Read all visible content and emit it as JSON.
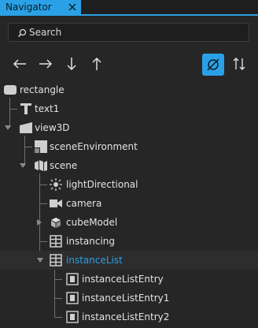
{
  "window": {
    "tab_title": "Navigator"
  },
  "search": {
    "placeholder": "Search",
    "value": ""
  },
  "toolbar": {
    "buttons": [
      {
        "icon": "arrow-left-icon"
      },
      {
        "icon": "arrow-right-icon"
      },
      {
        "icon": "arrow-down-icon"
      },
      {
        "icon": "arrow-up-icon"
      },
      {
        "icon": "hide-unused-icon",
        "active": true
      },
      {
        "icon": "sort-icon"
      }
    ]
  },
  "tree": {
    "items": [
      {
        "label": "rectangle",
        "icon": "rectangle-icon",
        "depth": 0
      },
      {
        "label": "text1",
        "icon": "text-icon",
        "depth": 1
      },
      {
        "label": "view3D",
        "icon": "view3d-icon",
        "depth": 1,
        "expanded": true
      },
      {
        "label": "sceneEnvironment",
        "icon": "scene-environment-icon",
        "depth": 2
      },
      {
        "label": "scene",
        "icon": "scene-icon",
        "depth": 2,
        "expanded": true
      },
      {
        "label": "lightDirectional",
        "icon": "light-icon",
        "depth": 3
      },
      {
        "label": "camera",
        "icon": "camera-icon",
        "depth": 3
      },
      {
        "label": "cubeModel",
        "icon": "model-icon",
        "depth": 3,
        "expanded": false
      },
      {
        "label": "instancing",
        "icon": "instancing-icon",
        "depth": 3
      },
      {
        "label": "instanceList",
        "icon": "instance-list-icon",
        "depth": 3,
        "expanded": true,
        "selected": true
      },
      {
        "label": "instanceListEntry",
        "icon": "instance-entry-icon",
        "depth": 4
      },
      {
        "label": "instanceListEntry1",
        "icon": "instance-entry-icon",
        "depth": 4
      },
      {
        "label": "instanceListEntry2",
        "icon": "instance-entry-icon",
        "depth": 4
      }
    ]
  },
  "colors": {
    "accent": "#2aa1e6",
    "background": "#262626",
    "text": "#e3e3e3"
  }
}
